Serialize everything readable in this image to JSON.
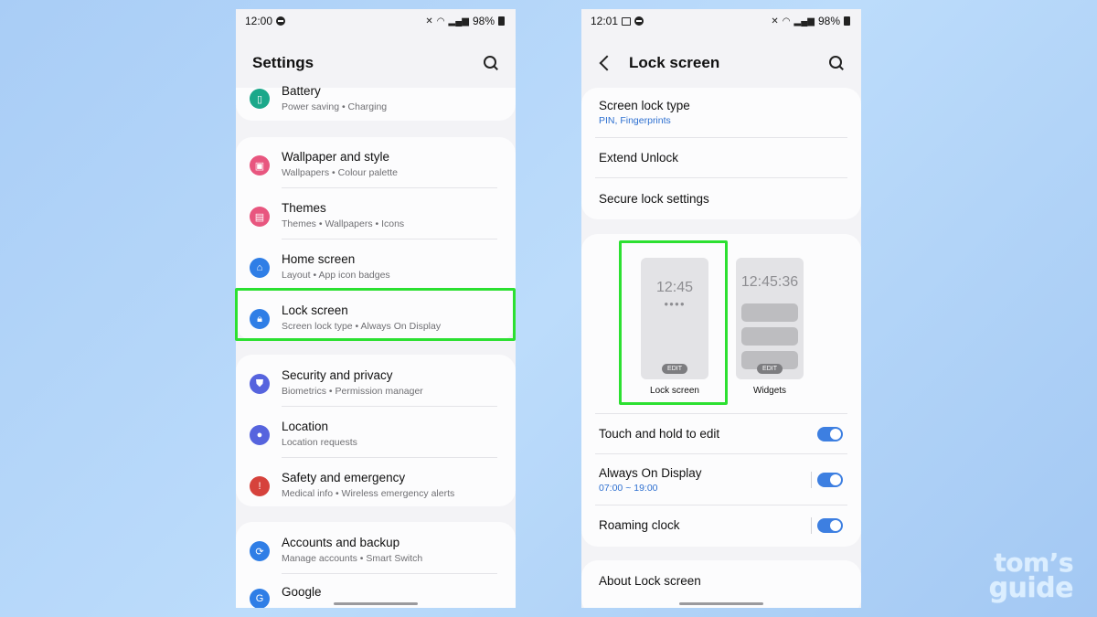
{
  "left_phone": {
    "status": {
      "time": "12:00",
      "battery": "98%"
    },
    "title": "Settings",
    "items": [
      {
        "title": "Battery",
        "sub": "Power saving  •  Charging",
        "color": "#1ba88a",
        "icon": "battery-icon"
      },
      {
        "title": "Wallpaper and style",
        "sub": "Wallpapers  •  Colour palette",
        "color": "#e8567f",
        "icon": "wallpaper-icon"
      },
      {
        "title": "Themes",
        "sub": "Themes  •  Wallpapers  •  Icons",
        "color": "#e8567f",
        "icon": "themes-icon"
      },
      {
        "title": "Home screen",
        "sub": "Layout  •  App icon badges",
        "color": "#2f7ee6",
        "icon": "home-icon"
      },
      {
        "title": "Lock screen",
        "sub": "Screen lock type  •  Always On Display",
        "color": "#2f7ee6",
        "icon": "lock-icon"
      },
      {
        "title": "Security and privacy",
        "sub": "Biometrics  •  Permission manager",
        "color": "#5664de",
        "icon": "shield-icon"
      },
      {
        "title": "Location",
        "sub": "Location requests",
        "color": "#5664de",
        "icon": "location-pin-icon"
      },
      {
        "title": "Safety and emergency",
        "sub": "Medical info  •  Wireless emergency alerts",
        "color": "#d6423c",
        "icon": "emergency-icon"
      },
      {
        "title": "Accounts and backup",
        "sub": "Manage accounts  •  Smart Switch",
        "color": "#2f7ee6",
        "icon": "sync-icon"
      },
      {
        "title": "Google",
        "sub": "",
        "color": "#2f7ee6",
        "icon": "google-icon"
      }
    ]
  },
  "right_phone": {
    "status": {
      "time": "12:01",
      "battery": "98%"
    },
    "title": "Lock screen",
    "security": [
      {
        "title": "Screen lock type",
        "sub": "PIN, Fingerprints"
      },
      {
        "title": "Extend Unlock"
      },
      {
        "title": "Secure lock settings"
      }
    ],
    "previews": {
      "lock": {
        "time": "12:45",
        "edit": "EDIT",
        "label": "Lock screen"
      },
      "widgets": {
        "time": "12:45:36",
        "edit": "EDIT",
        "label": "Widgets"
      }
    },
    "toggles": [
      {
        "title": "Touch and hold to edit",
        "on": true
      },
      {
        "title": "Always On Display",
        "sub": "07:00 ~ 19:00",
        "on": true
      },
      {
        "title": "Roaming clock",
        "on": true
      }
    ],
    "about": "About Lock screen"
  },
  "logo": {
    "line1": "tom’s",
    "line2": "guide"
  },
  "colors": {
    "highlight": "#2ce031",
    "toggle": "#3d7fe1",
    "accent_text": "#2d6fd0"
  }
}
